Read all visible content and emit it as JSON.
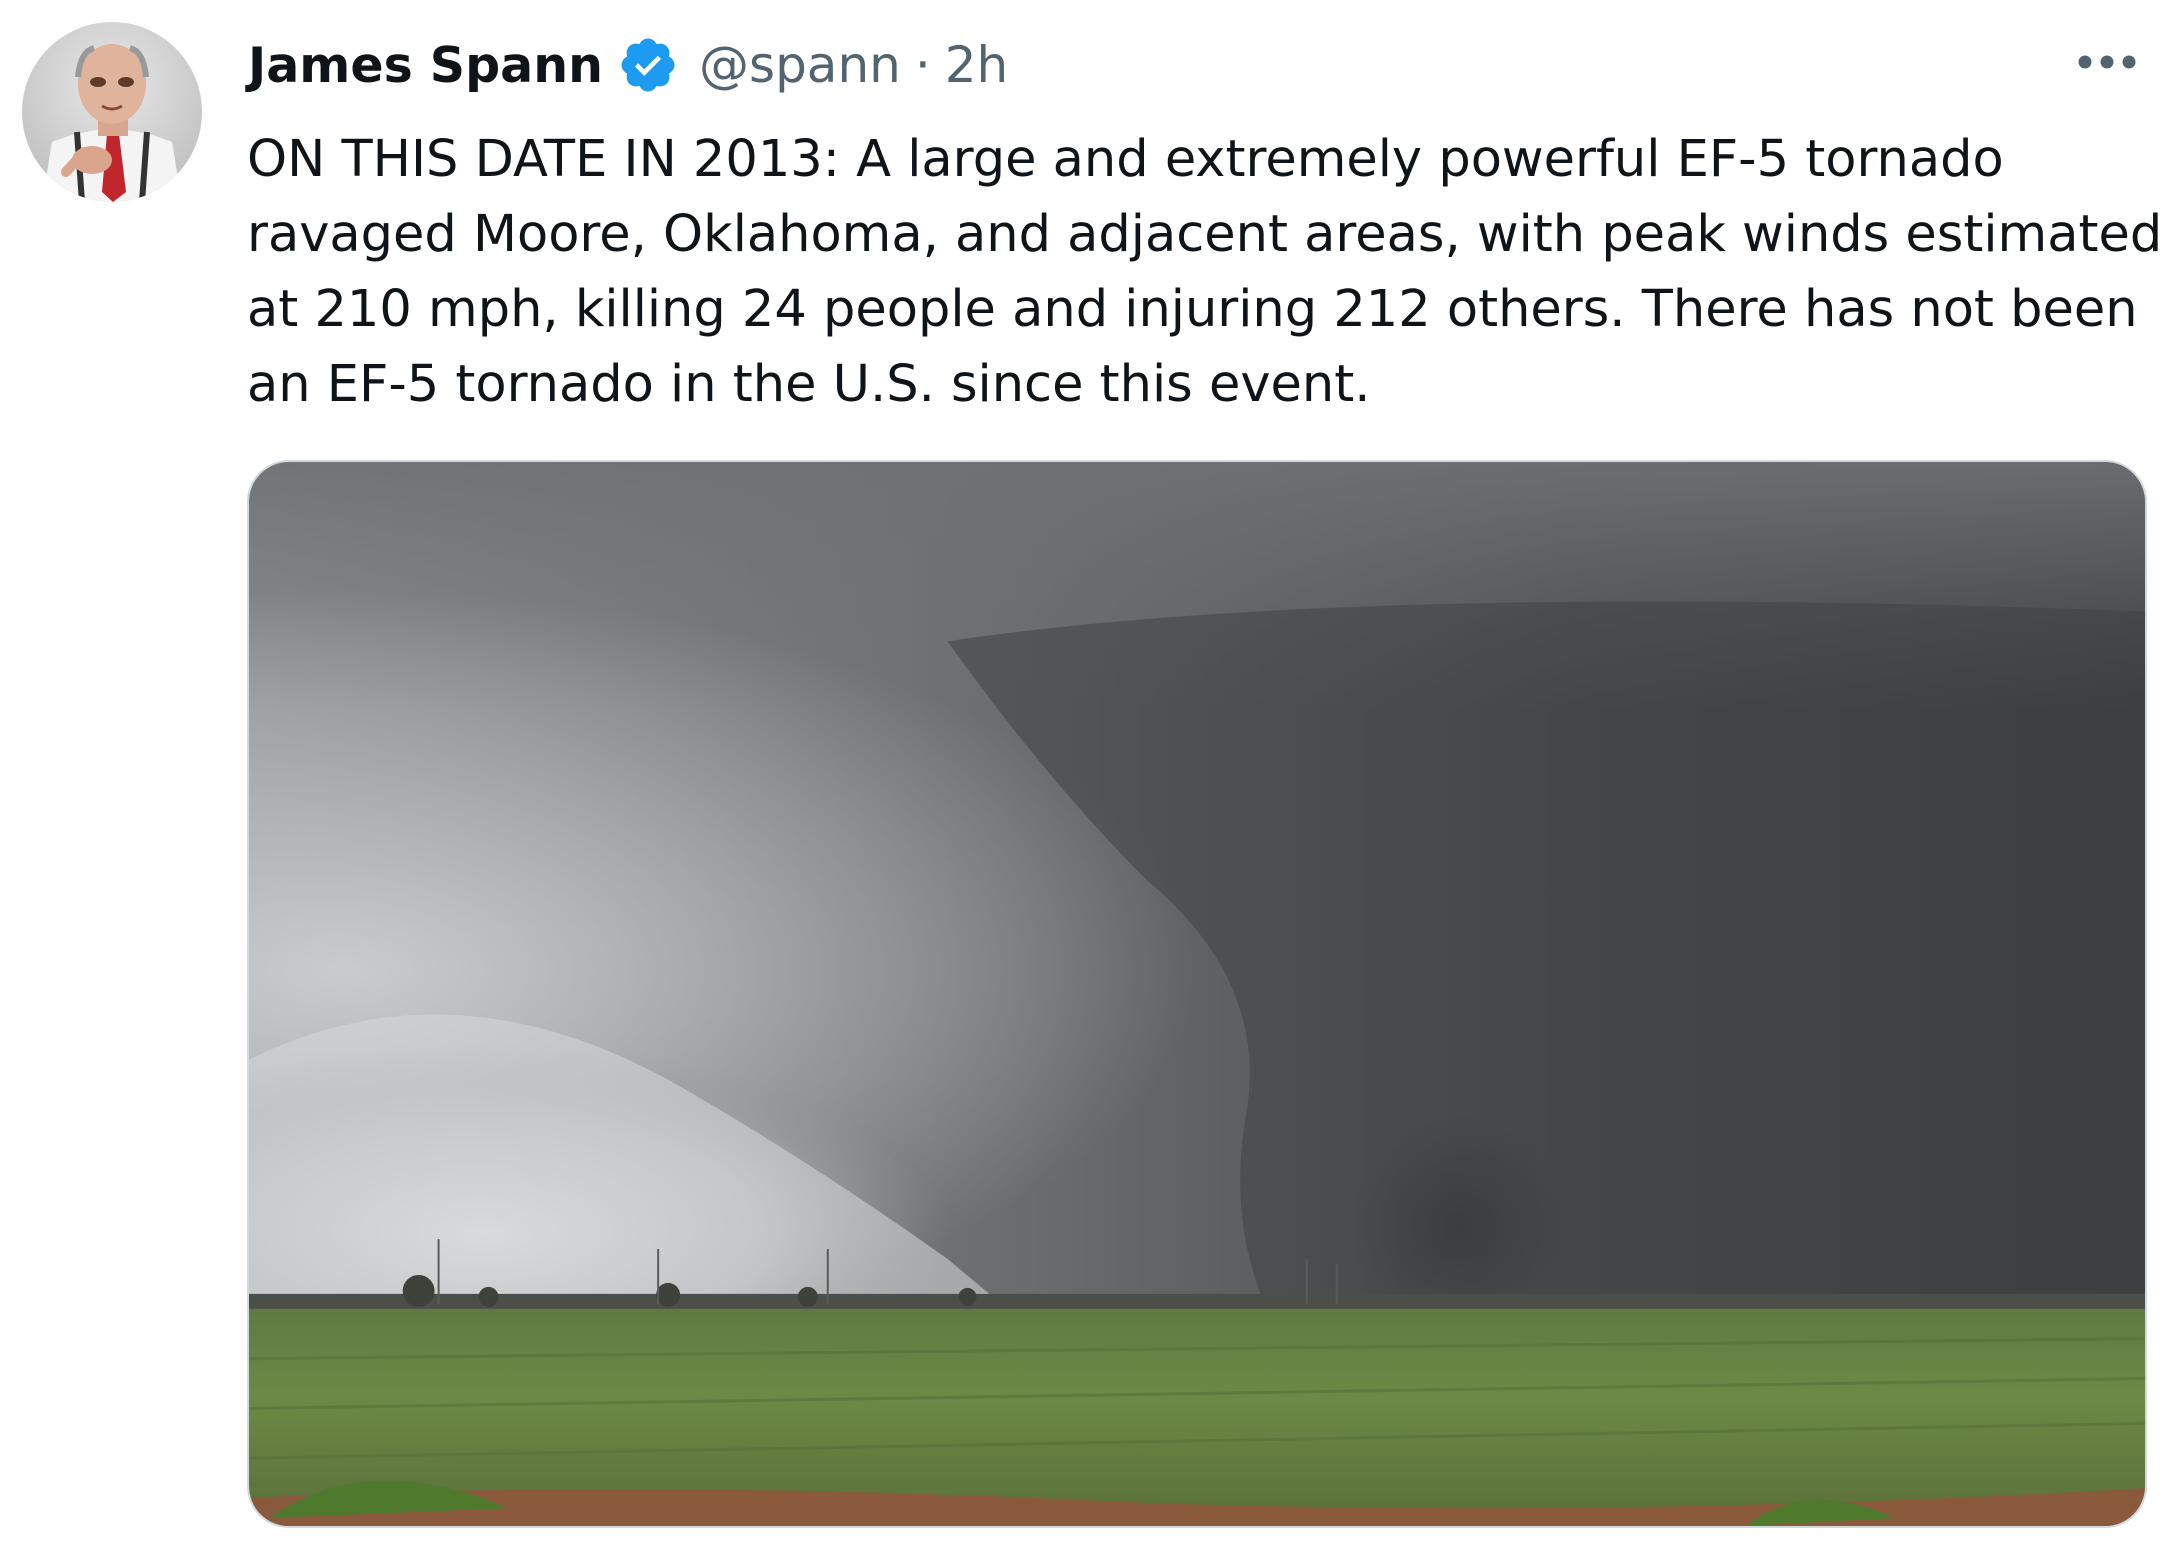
{
  "tweet": {
    "author": {
      "display_name": "James Spann",
      "handle": "@spann",
      "verified": true,
      "avatar_icon": "profile-photo"
    },
    "separator": "·",
    "time": "2h",
    "text": "ON THIS DATE IN 2013: A large and extremely powerful EF-5 tornado ravaged Moore, Oklahoma, and adjacent areas, with peak winds estimated at 210 mph, killing 24 people and injuring 212 others. There has not been an EF-5 tornado in the U.S. since this event.",
    "more_icon": "more-horizontal-icon",
    "media": {
      "type": "photo",
      "subject": "tornado over a green field"
    }
  },
  "colors": {
    "text_primary": "#0f1419",
    "text_secondary": "#536471",
    "verified_blue": "#1d9bf0",
    "media_border": "#cfd9de"
  }
}
